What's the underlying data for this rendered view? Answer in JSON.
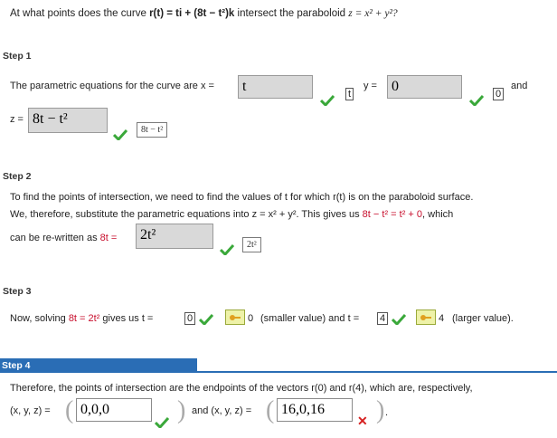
{
  "question": {
    "lead": "At what points does the curve",
    "curve": "r(t) = ti + (8t − t²)k",
    "mid": "intersect the paraboloid",
    "surface": "z = x² + y²?"
  },
  "step1": {
    "label": "Step 1",
    "sentence": "The parametric equations for the curve are x =",
    "x_value": "t",
    "y_label": "y =",
    "y_value": "0",
    "and": "and",
    "z_label": "z =",
    "z_value": "8t − t²",
    "x_preview": "t",
    "y_preview": "0",
    "z_preview": "8t − t²"
  },
  "step2": {
    "label": "Step 2",
    "line1": "To find the points of intersection, we need to find the values of t for which  r(t)  is on the paraboloid surface.",
    "line2a": "We, therefore, substitute the parametric equations into  z = x² + y².  This gives us ",
    "line2b": "8t − t² = t² + 0",
    "line2c": ",  which",
    "line3a": "can be re-written as ",
    "line3b": "8t =",
    "value": "2t²",
    "preview": "2t²"
  },
  "step3": {
    "label": "Step 3",
    "text_a": "Now, solving ",
    "text_b": "8t = 2t²",
    "text_c": " gives us  t =",
    "t1": "0",
    "t1_key": "0",
    "text_d": "(smaller value) and  t =",
    "t2": "4",
    "t2_key": "4",
    "text_e": "(larger value)."
  },
  "step4": {
    "label": "Step 4",
    "line1": "Therefore, the points of intersection are the endpoints of the vectors  r(0)  and  r(4),  which are, respectively,",
    "xyz_label": "(x, y, z) =",
    "p1": "0,0,0",
    "and": "and  (x, y, z) =",
    "p2": "16,0,16",
    "end": "."
  },
  "colors": {
    "check": "#3aa83a",
    "cross": "#d62020",
    "step4_bar": "#2a6db5"
  }
}
